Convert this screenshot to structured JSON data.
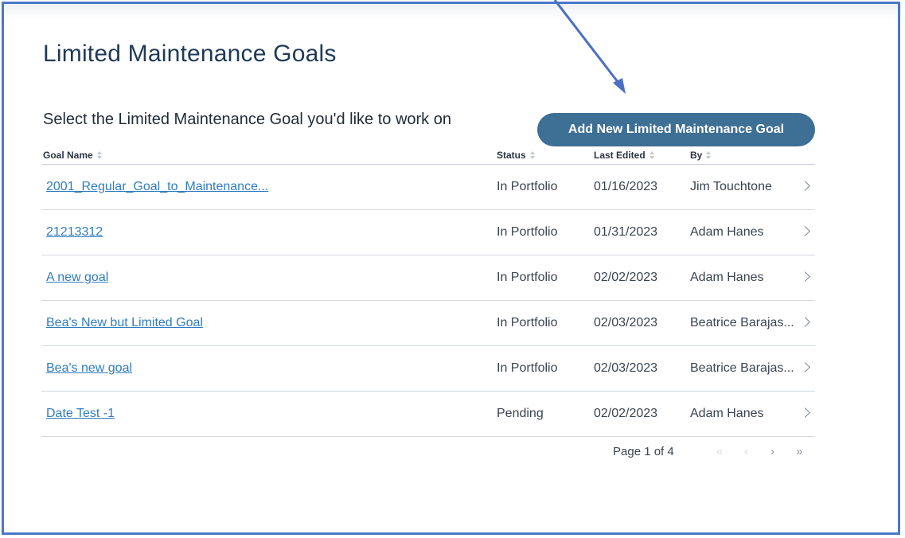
{
  "page": {
    "title": "Limited Maintenance Goals",
    "subtitle": "Select the Limited Maintenance Goal you'd like to work on",
    "add_button_label": "Add New Limited Maintenance Goal"
  },
  "table": {
    "columns": [
      "Goal Name",
      "Status",
      "Last Edited",
      "By"
    ],
    "rows": [
      {
        "name": "2001_Regular_Goal_to_Maintenance...",
        "status": "In Portfolio",
        "last_edited": "01/16/2023",
        "by": "Jim Touchtone"
      },
      {
        "name": "21213312",
        "status": "In Portfolio",
        "last_edited": "01/31/2023",
        "by": "Adam Hanes"
      },
      {
        "name": "A new goal",
        "status": "In Portfolio",
        "last_edited": "02/02/2023",
        "by": "Adam Hanes"
      },
      {
        "name": "Bea's New but Limited Goal",
        "status": "In Portfolio",
        "last_edited": "02/03/2023",
        "by": "Beatrice Barajas..."
      },
      {
        "name": "Bea's new goal",
        "status": "In Portfolio",
        "last_edited": "02/03/2023",
        "by": "Beatrice Barajas..."
      },
      {
        "name": "Date Test -1",
        "status": "Pending",
        "last_edited": "02/02/2023",
        "by": "Adam Hanes"
      }
    ]
  },
  "pagination": {
    "label": "Page 1 of 4",
    "first": "«",
    "prev": "‹",
    "next": "›",
    "last": "»"
  },
  "colors": {
    "accent_button": "#3e6f95",
    "link": "#2f7cc0",
    "annotation_arrow": "#4a6fc4",
    "frame_border": "#4a78c8"
  }
}
